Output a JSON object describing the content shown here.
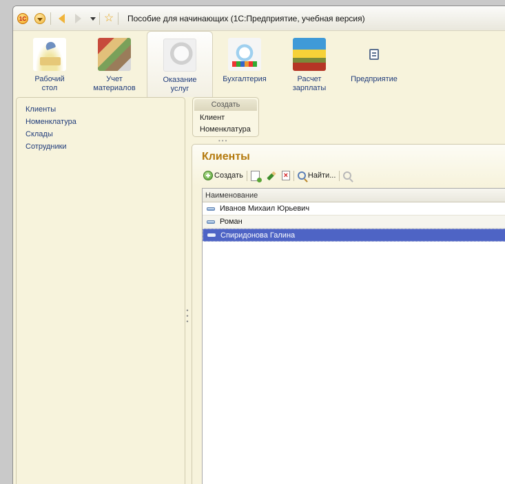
{
  "window": {
    "title": "Пособие для начинающих  (1С:Предприятие, учебная версия)",
    "logo_text": "1С"
  },
  "sections": [
    {
      "label": "Рабочий\nстол",
      "icon": "desktop-lamp-icon"
    },
    {
      "label": "Учет\nматериалов",
      "icon": "materials-icon"
    },
    {
      "label": "Оказание\nуслуг",
      "icon": "services-icon",
      "active": true
    },
    {
      "label": "Бухгалтерия",
      "icon": "accounting-icon"
    },
    {
      "label": "Расчет\nзарплаты",
      "icon": "salary-icon"
    },
    {
      "label": "Предприятие",
      "icon": "enterprise-icon"
    }
  ],
  "navigation": {
    "items": [
      "Клиенты",
      "Номенклатура",
      "Склады",
      "Сотрудники"
    ]
  },
  "create_panel": {
    "header": "Создать",
    "items": [
      "Клиент",
      "Номенклатура"
    ]
  },
  "form": {
    "title": "Клиенты",
    "toolbar": {
      "create_label": "Создать",
      "find_label": "Найти..."
    },
    "table": {
      "column_header": "Наименование",
      "rows": [
        "Иванов Михаил Юрьевич",
        "Роман",
        "Спиридонова Галина"
      ],
      "selected_index": 2
    }
  },
  "colors": {
    "form_title": "#b3780b",
    "selection": "#4e64c5",
    "link": "#1f3b7a",
    "panel_bg": "#f7f3dc"
  }
}
